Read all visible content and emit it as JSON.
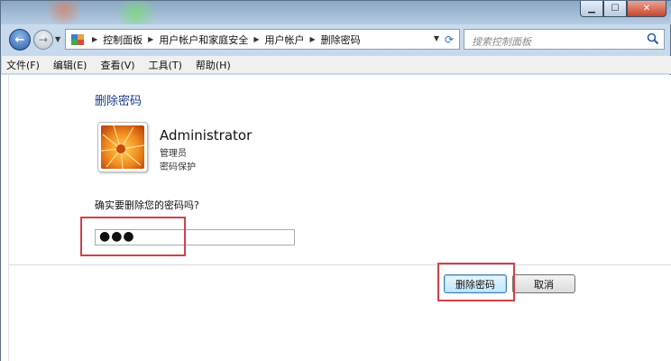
{
  "window": {
    "controls": {
      "minimize": "▁",
      "maximize": "☐",
      "close": "✕"
    }
  },
  "nav": {
    "back_glyph": "←",
    "forward_glyph": "→",
    "breadcrumb": [
      "控制面板",
      "用户帐户和家庭安全",
      "用户帐户",
      "删除密码"
    ],
    "search_placeholder": "搜索控制面板"
  },
  "menu": [
    "文件(F)",
    "编辑(E)",
    "查看(V)",
    "工具(T)",
    "帮助(H)"
  ],
  "page": {
    "title": "删除密码",
    "user": {
      "name": "Administrator",
      "role": "管理员",
      "status": "密码保护"
    },
    "confirm_prompt": "确实要删除您的密码吗?",
    "password_value": "●●●",
    "buttons": {
      "delete": "删除密码",
      "cancel": "取消"
    }
  },
  "colors": {
    "title": "#1e3b8a",
    "highlight": "#d3414a",
    "primary_button": "#bee6fd"
  }
}
